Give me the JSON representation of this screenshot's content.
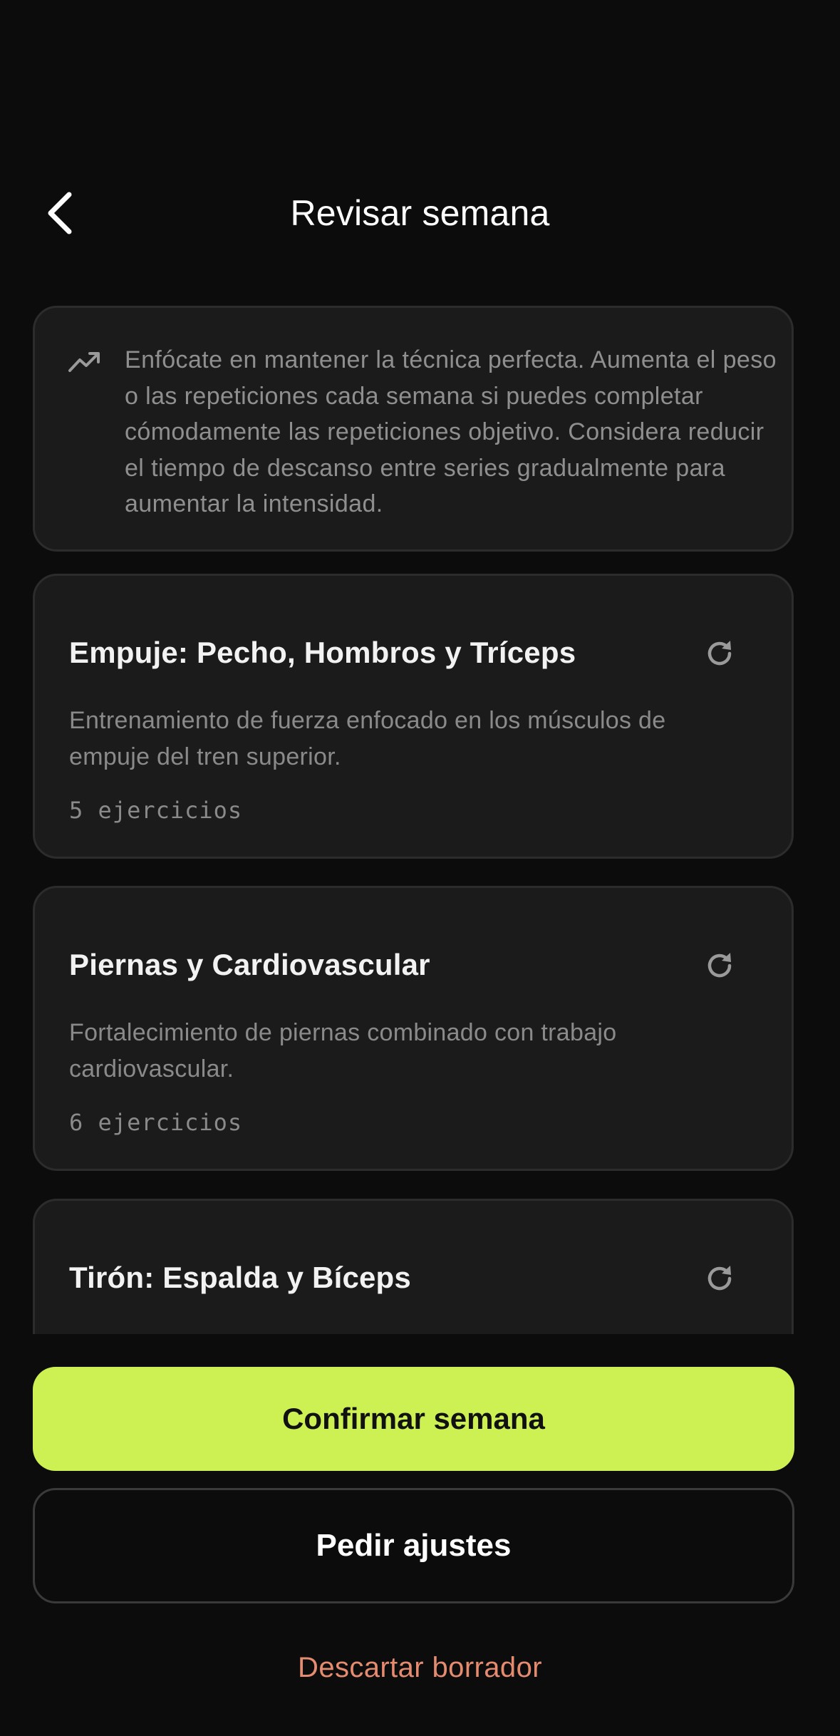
{
  "header": {
    "title": "Revisar semana",
    "back_icon": "chevron-left-icon"
  },
  "tip": {
    "icon": "trending-up-icon",
    "text": "Enfócate en mantener la técnica perfecta. Aumenta el peso o las repeticiones cada semana si puedes completar cómodamente las repeticiones objetivo. Considera reducir el tiempo de descanso entre series gradualmente para aumentar la intensidad."
  },
  "workouts": [
    {
      "title": "Empuje: Pecho, Hombros y Tríceps",
      "description": "Entrenamiento de fuerza enfocado en los músculos de empuje del tren superior.",
      "count": "5 ejercicios"
    },
    {
      "title": "Piernas y Cardiovascular",
      "description": "Fortalecimiento de piernas combinado con trabajo cardiovascular.",
      "count": "6 ejercicios"
    },
    {
      "title": "Tirón: Espalda y Bíceps"
    }
  ],
  "actions": {
    "confirm_label": "Confirmar semana",
    "adjust_label": "Pedir ajustes",
    "discard_label": "Descartar borrador"
  },
  "colors": {
    "background": "#0c0c0c",
    "card": "#1b1b1b",
    "accent": "#cdf152",
    "destructive": "#e58b6f"
  }
}
